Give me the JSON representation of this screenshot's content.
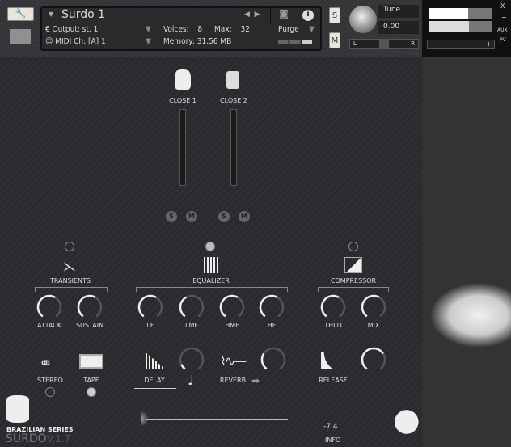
{
  "header": {
    "instrument_name": "Surdo 1",
    "output_label": "Output:",
    "output_value": "st. 1",
    "voices_label": "Voices:",
    "voices_value": "8",
    "max_label": "Max:",
    "max_value": "32",
    "midi_label": "MIDI Ch:",
    "midi_value": "[A]  1",
    "memory_label": "Memory:",
    "memory_value": "31.56 MB",
    "purge_label": "Purge",
    "solo_label": "S",
    "mute_label": "M",
    "tune_label": "Tune",
    "tune_value": "0.00",
    "pan_left": "L",
    "pan_right": "R",
    "vol_minus": "−",
    "vol_plus": "+",
    "close_label": "X",
    "min_label": "−",
    "aux_label": "AUX",
    "pv_label": "PV"
  },
  "mics": [
    {
      "label": "CLOSE 1",
      "solo": "S",
      "mute": "M"
    },
    {
      "label": "CLOSE 2",
      "solo": "S",
      "mute": "M"
    }
  ],
  "sections": {
    "transients": "TRANSIENTS",
    "equalizer": "EQUALIZER",
    "compressor": "COMPRESSOR"
  },
  "knobs": [
    {
      "label": "ATTACK",
      "value": 0.6
    },
    {
      "label": "SUSTAIN",
      "value": 0.6
    },
    {
      "label": "LF",
      "value": 0.6
    },
    {
      "label": "LMF",
      "value": 0.4
    },
    {
      "label": "HMF",
      "value": 0.6
    },
    {
      "label": "HF",
      "value": 0.6
    },
    {
      "label": "THLD",
      "value": 0.6
    },
    {
      "label": "MIX",
      "value": 0.6
    }
  ],
  "effects": {
    "stereo": "STEREO",
    "tape": "TAPE",
    "delay": "DELAY",
    "reverb": "REVERB",
    "release": "RELEASE",
    "delay_knob": 0.1,
    "reverb_knob": 0.3,
    "release_knob": 0.7
  },
  "footer": {
    "series": "BRAZILIAN SERIES",
    "product": "SURDO",
    "version": "V.1.7",
    "level": "-7.4",
    "info": "INFO"
  }
}
